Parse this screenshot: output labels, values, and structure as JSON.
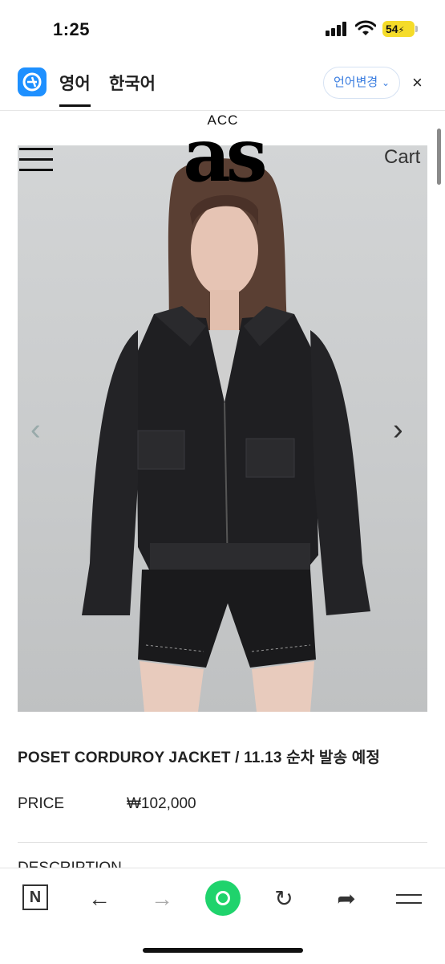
{
  "status_bar": {
    "time": "1:25",
    "battery": "54"
  },
  "translate_bar": {
    "active_language": "영어",
    "other_language": "한국어",
    "change_language_label": "언어변경",
    "close_symbol": "×",
    "icons": [
      "translate-app-icon",
      "close-icon",
      "chevron-down-icon"
    ]
  },
  "site_header": {
    "brand_small": "ACC",
    "brand_logo": "as",
    "cart_label": "Cart",
    "menu_icon": "hamburger-icon"
  },
  "product": {
    "title": "POSET CORDUROY JACKET / 11.13 순차 발송 예정",
    "price_label": "PRICE",
    "price_value": "₩102,000",
    "description_label": "DESCRIPTION"
  },
  "carousel": {
    "prev_symbol": "‹",
    "next_symbol": "›"
  },
  "browser_toolbar": {
    "n_label": "N",
    "back_symbol": "←",
    "forward_symbol": "→",
    "reload_symbol": "↻",
    "share_symbol": "➦"
  },
  "colors": {
    "accent_blue": "#3a7de0",
    "app_icon_blue": "#1e90ff",
    "home_green": "#1fd36c",
    "battery_yellow": "#f5dc2a"
  }
}
